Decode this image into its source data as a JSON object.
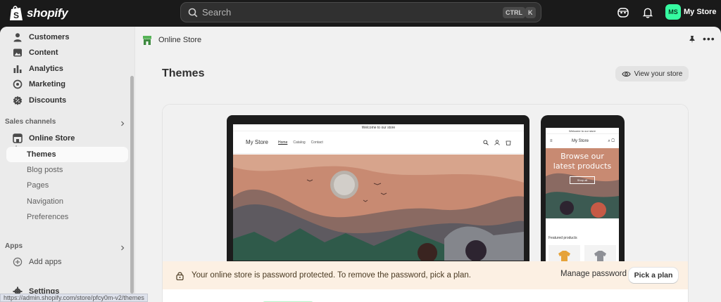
{
  "topbar": {
    "logo_text": "shopify",
    "search_placeholder": "Search",
    "shortcut_ctrl": "CTRL",
    "shortcut_k": "K",
    "avatar_initials": "MS",
    "store_name": "My Store",
    "colors": {
      "bg": "#1a1a1a",
      "avatar": "#36fba1"
    }
  },
  "sidebar": {
    "items": [
      {
        "label": "Customers",
        "icon": "person-icon"
      },
      {
        "label": "Content",
        "icon": "image-icon"
      },
      {
        "label": "Analytics",
        "icon": "bar-chart-icon"
      },
      {
        "label": "Marketing",
        "icon": "target-icon"
      },
      {
        "label": "Discounts",
        "icon": "discount-icon"
      }
    ],
    "sales_channels_label": "Sales channels",
    "online_store_label": "Online Store",
    "online_store_sub": [
      "Themes",
      "Blog posts",
      "Pages",
      "Navigation",
      "Preferences"
    ],
    "apps_label": "Apps",
    "add_apps_label": "Add apps",
    "settings_label": "Settings"
  },
  "status_url": "https://admin.shopify.com/store/pfcy0m-v2/themes",
  "main": {
    "breadcrumb": "Online Store",
    "title": "Themes",
    "view_store_label": "View your store",
    "more_label": "•••"
  },
  "preview": {
    "announcement": "Welcome to our store",
    "store_name": "My Store",
    "nav": [
      "Home",
      "Catalog",
      "Contact"
    ],
    "phone_announcement": "Welcome to our store",
    "phone_store_name": "My Store",
    "phone_hero": "Browse our latest products",
    "phone_shop_all": "Shop all",
    "featured_label": "Featured products"
  },
  "banner": {
    "message": "Your online store is password protected. To remove the password, pick a plan.",
    "manage_label": "Manage password",
    "pick_label": "Pick a plan",
    "color": "#fcf0e3"
  }
}
